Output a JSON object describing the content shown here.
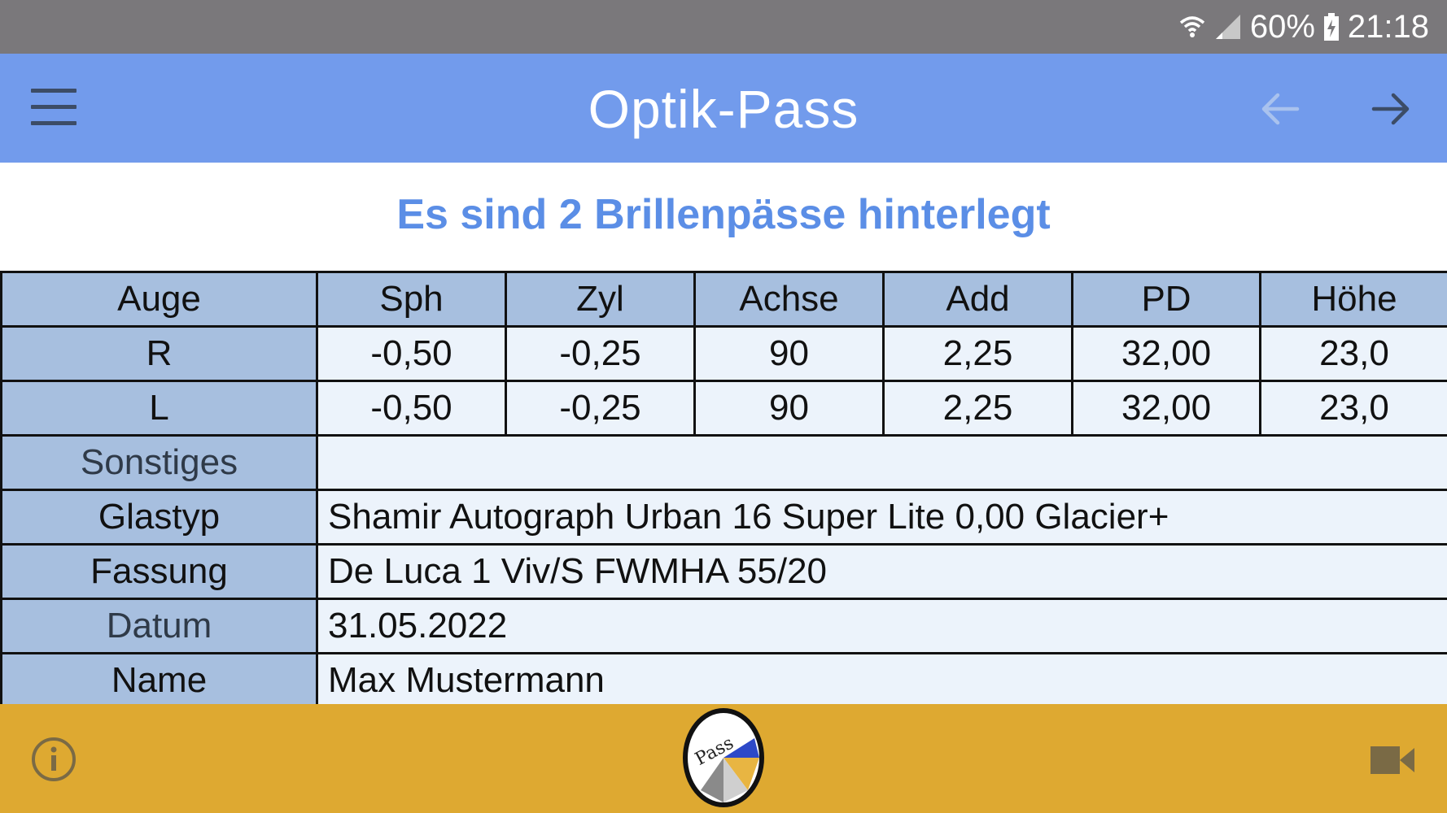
{
  "status_bar": {
    "battery": "60%",
    "time": "21:18",
    "icons": [
      "wifi-icon",
      "signal-icon",
      "battery-charging-icon"
    ]
  },
  "app_bar": {
    "title": "Optik-Pass",
    "icons": [
      "menu-icon",
      "arrow-left-icon",
      "arrow-right-icon"
    ]
  },
  "headline": "Es sind 2 Brillenpässe hinterlegt",
  "table": {
    "headers": [
      "Auge",
      "Sph",
      "Zyl",
      "Achse",
      "Add",
      "PD",
      "Höhe"
    ],
    "rows": [
      [
        "R",
        "-0,50",
        "-0,25",
        "90",
        "2,25",
        "32,00",
        "23,0"
      ],
      [
        "L",
        "-0,50",
        "-0,25",
        "90",
        "2,25",
        "32,00",
        "23,0"
      ]
    ],
    "details": [
      {
        "label": "Sonstiges",
        "value": ""
      },
      {
        "label": "Glastyp",
        "value": "Shamir Autograph Urban 16 Super Lite  0,00  Glacier+"
      },
      {
        "label": "Fassung",
        "value": "De Luca  1 Viv/S FWMHA 55/20"
      },
      {
        "label": "Datum",
        "value": "31.05.2022"
      },
      {
        "label": "Name",
        "value": "Max Mustermann"
      }
    ]
  },
  "bottom_bar": {
    "logo_text": "Pass",
    "icons": [
      "info-icon",
      "pass-logo",
      "video-camera-icon"
    ]
  },
  "colors": {
    "status_bar": "#7a787b",
    "app_bar": "#729bec",
    "headline": "#5b8ee6",
    "table_header": "#a7bfdf",
    "table_cell": "#ecf3fb",
    "bottom_bar": "#dea931"
  }
}
